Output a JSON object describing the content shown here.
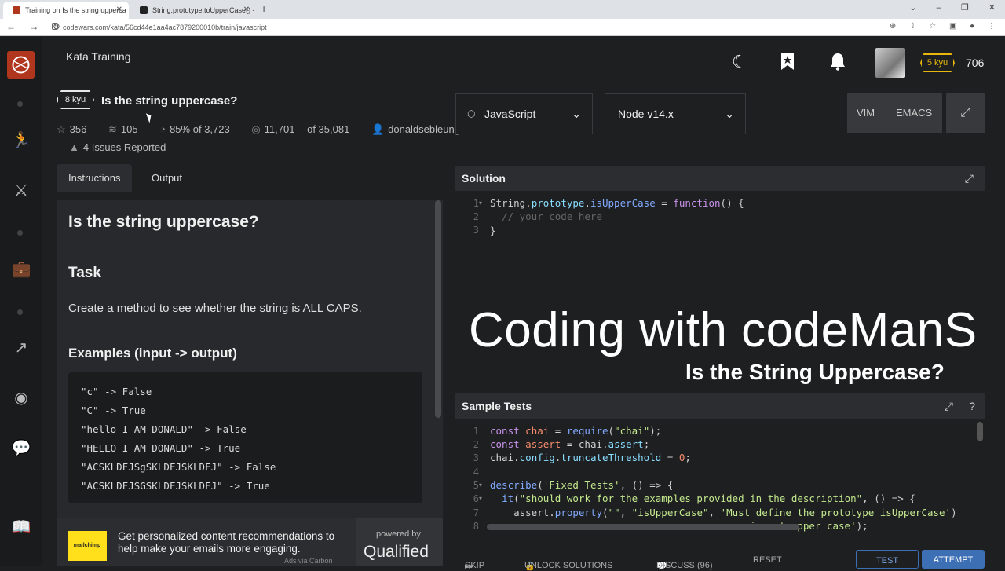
{
  "browser": {
    "tabs": [
      {
        "title": "Training on Is the string upperca",
        "active": true
      },
      {
        "title": "String.prototype.toUpperCase() -",
        "active": false
      }
    ],
    "url": "codewars.com/kata/56cd44e1aa4ac7879200010b/train/javascript"
  },
  "header": {
    "title": "Kata Training",
    "rank": "5 kyu",
    "honor": "706"
  },
  "kata": {
    "kyu": "8 kyu",
    "title": "Is the string uppercase?",
    "stars": "356",
    "collections": "105",
    "satisfaction": "85% of 3,723",
    "completed": "11,701",
    "completed_of": "of 35,081",
    "author": "donaldsebleung",
    "issues": "4 Issues Reported"
  },
  "left_tabs": [
    "Instructions",
    "Output"
  ],
  "instructions": {
    "heading": "Is the string uppercase?",
    "task_heading": "Task",
    "task_text": "Create a method to see whether the string is ALL CAPS.",
    "examples_heading": "Examples (input -> output)",
    "examples": [
      "\"c\" -> False",
      "\"C\" -> True",
      "\"hello I AM DONALD\" -> False",
      "\"HELLO I AM DONALD\" -> True",
      "\"ACSKLDFJSgSKLDFJSKLDFJ\" -> False",
      "\"ACSKLDFJSGSKLDFJSKLDFJ\" -> True"
    ]
  },
  "ad": {
    "brand": "mailchimp",
    "text": "Get personalized content recommendations to help make your emails more engaging.",
    "note": "Ads via Carbon",
    "powered": "powered by",
    "qualified": "Qualified"
  },
  "editor": {
    "language": "JavaScript",
    "version": "Node v14.x",
    "vim": "VIM",
    "emacs": "EMACS",
    "solution_title": "Solution",
    "tests_title": "Sample Tests"
  },
  "overlay": {
    "line1": "Coding with codeManS",
    "line2": "Is the String Uppercase?"
  },
  "bottom": {
    "skip": "SKIP",
    "unlock": "UNLOCK SOLUTIONS",
    "discuss": "DISCUSS (96)",
    "reset": "RESET",
    "test": "TEST",
    "attempt": "ATTEMPT"
  },
  "colors": {
    "accent": "#e8b70d",
    "logo": "#b1361e",
    "attempt": "#3d6fb5"
  }
}
